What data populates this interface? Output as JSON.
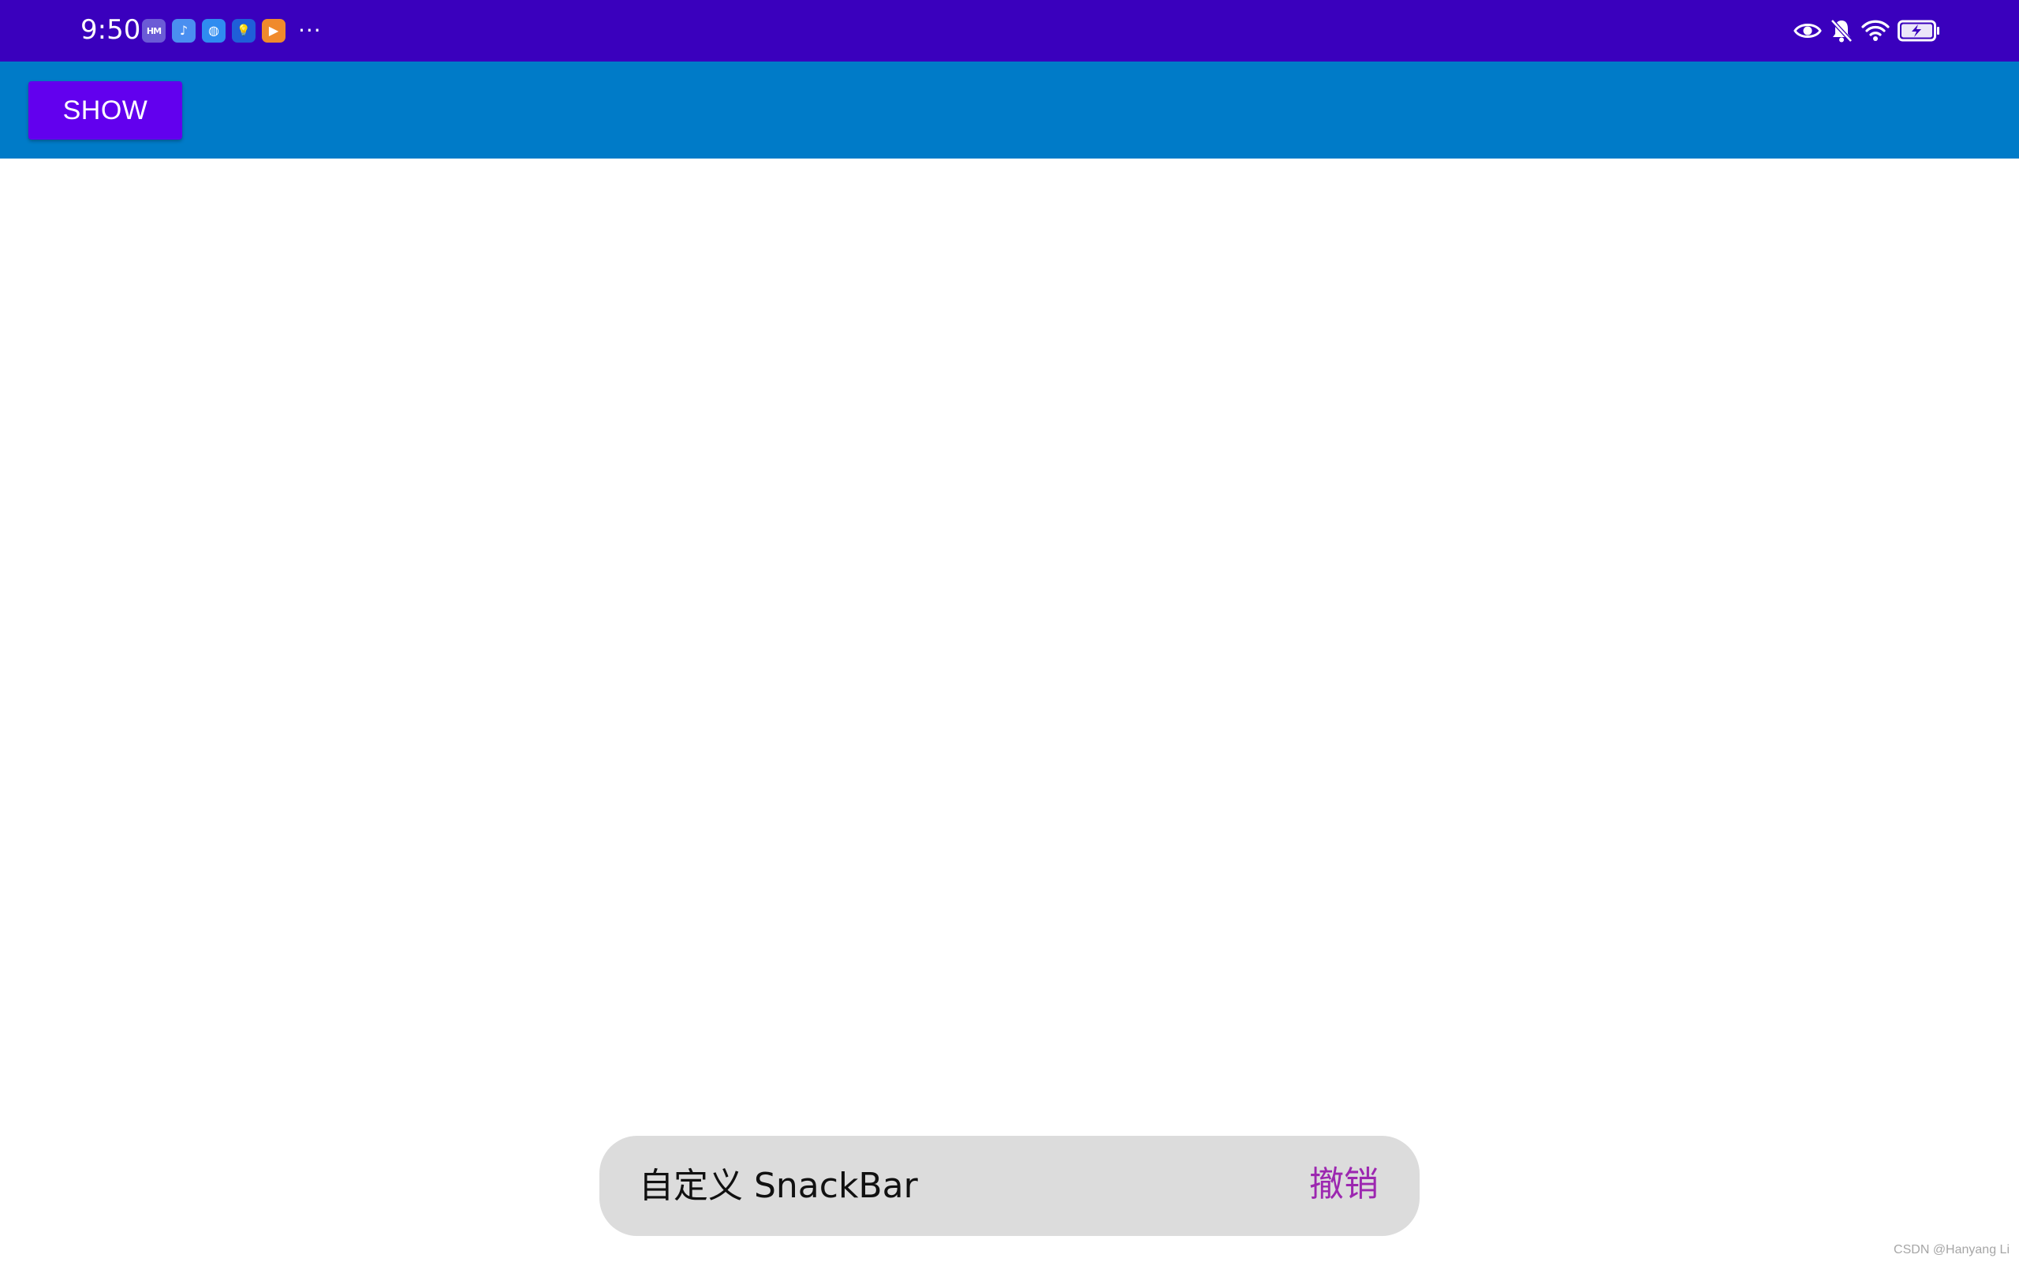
{
  "status_bar": {
    "time": "9:50",
    "notification_icons": [
      {
        "name": "hmos-app-icon",
        "glyph": "HM",
        "color": "#6b5bd6"
      },
      {
        "name": "music-app-icon",
        "glyph": "♪",
        "color": "#4a8ff0"
      },
      {
        "name": "browser-app-icon",
        "glyph": "◍",
        "color": "#2f8cf0"
      },
      {
        "name": "tips-app-icon",
        "glyph": "💡",
        "color": "#1f5fd8"
      },
      {
        "name": "video-app-icon",
        "glyph": "▶",
        "color": "#f08a2c"
      }
    ],
    "more_indicator": "···",
    "system_icons": [
      "eye-comfort-icon",
      "mute-bell-icon",
      "wifi-icon",
      "battery-charging-icon"
    ]
  },
  "toolbar": {
    "background_color": "#007bc8",
    "show_label": "SHOW",
    "show_button_color": "#6200ee"
  },
  "snackbar": {
    "message": "自定义 SnackBar",
    "action_label": "撤销",
    "action_color": "#9c27b0",
    "background_color": "#dcdcdc"
  },
  "watermark": "CSDN @Hanyang Li"
}
